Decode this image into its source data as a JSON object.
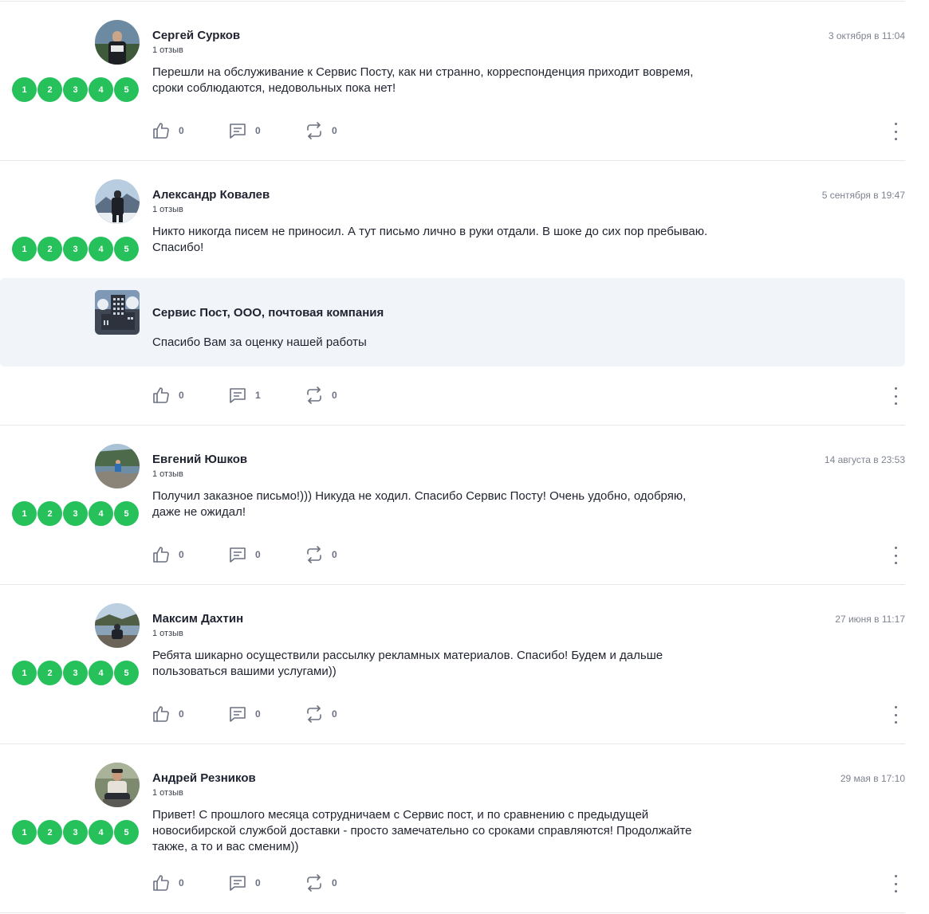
{
  "reviews": [
    {
      "author": "Сергей Сурков",
      "reviews_count": "1 отзыв",
      "date": "3 октября в 11:04",
      "rating_buttons": [
        "1",
        "2",
        "3",
        "4",
        "5"
      ],
      "text_lines": [
        "Перешли на обслуживание к Сервис Посту, как ни странно, корреспонденция приходит вовремя,",
        "сроки соблюдаются, недовольных пока нет!"
      ],
      "likes": "0",
      "comments": "0",
      "reposts": "0"
    },
    {
      "author": "Александр Ковалев",
      "reviews_count": "1 отзыв",
      "date": "5 сентября в 19:47",
      "rating_buttons": [
        "1",
        "2",
        "3",
        "4",
        "5"
      ],
      "text_lines": [
        "Никто никогда писем не приносил. А тут письмо лично в руки отдали. В шоке до сих пор пребываю.",
        "Спасибо!"
      ],
      "reply": {
        "name": "Сервис Пост, ООО, почтовая компания",
        "text": "Спасибо Вам за оценку нашей работы"
      },
      "likes": "0",
      "comments": "1",
      "reposts": "0"
    },
    {
      "author": "Евгений Юшков",
      "reviews_count": "1 отзыв",
      "date": "14 августа в 23:53",
      "rating_buttons": [
        "1",
        "2",
        "3",
        "4",
        "5"
      ],
      "text_lines": [
        "Получил заказное письмо!))) Никуда не ходил. Спасибо Сервис Посту! Очень удобно, одобряю,",
        "даже не ожидал!"
      ],
      "likes": "0",
      "comments": "0",
      "reposts": "0"
    },
    {
      "author": "Максим Дахтин",
      "reviews_count": "1 отзыв",
      "date": "27 июня в 11:17",
      "rating_buttons": [
        "1",
        "2",
        "3",
        "4",
        "5"
      ],
      "text_lines": [
        "Ребята шикарно осуществили рассылку рекламных материалов. Спасибо! Будем и дальше",
        "пользоваться вашими услугами))"
      ],
      "likes": "0",
      "comments": "0",
      "reposts": "0"
    },
    {
      "author": "Андрей Резников",
      "reviews_count": "1 отзыв",
      "date": "29 мая в 17:10",
      "rating_buttons": [
        "1",
        "2",
        "3",
        "4",
        "5"
      ],
      "text_lines": [
        "Привет! С прошлого месяца сотрудничаем с Сервис пост, и по сравнению с предыдущей",
        "новосибирской службой доставки - просто замечательно со сроками справляются! Продолжайте",
        "также, а то и вас сменим))"
      ],
      "likes": "0",
      "comments": "0",
      "reposts": "0"
    }
  ],
  "colors": {
    "rating_green": "#26c15a",
    "reply_background": "#f1f4f9",
    "divider": "#e6e8ec",
    "muted_text": "#7d8390"
  },
  "icons": {
    "like": "thumbs-up-icon",
    "comment": "comment-icon",
    "repost": "repost-icon",
    "more": "more-vertical-icon"
  }
}
